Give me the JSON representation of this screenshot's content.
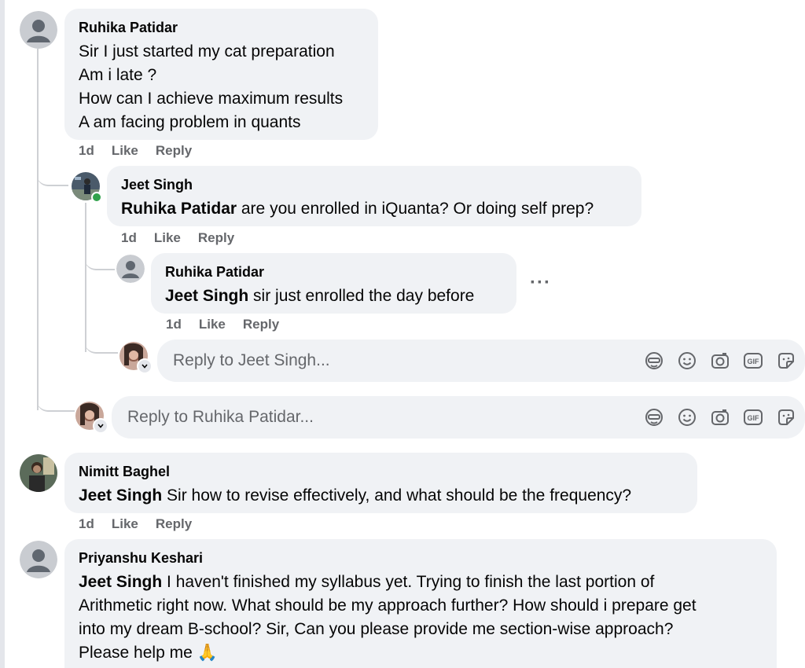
{
  "comments": {
    "c1": {
      "author": "Ruhika Patidar",
      "lines": [
        "Sir I just started my cat preparation",
        "Am i late ?",
        "How can I achieve maximum results",
        "A am facing problem in quants"
      ],
      "time": "1d",
      "like": "Like",
      "reply": "Reply"
    },
    "c2": {
      "author": "Jeet Singh",
      "mention": "Ruhika Patidar",
      "text": " are you enrolled in iQuanta? Or doing self prep?",
      "time": "1d",
      "like": "Like",
      "reply": "Reply"
    },
    "c3": {
      "author": "Ruhika Patidar",
      "mention": "Jeet Singh",
      "text": " sir just enrolled the day before",
      "time": "1d",
      "like": "Like",
      "reply": "Reply",
      "more": "···"
    },
    "c4": {
      "author": "Nimitt Baghel",
      "mention": "Jeet Singh",
      "text": " Sir how to revise effectively, and what should be the frequency?",
      "time": "1d",
      "like": "Like",
      "reply": "Reply"
    },
    "c5": {
      "author": "Priyanshu Keshari",
      "mention": "Jeet Singh",
      "line1": " I haven't finished my syllabus yet. Trying to finish the last portion of",
      "line2": "Arithmetic right now. What should be my approach further? How should i prepare get",
      "line3": "into my dream B-school? Sir, Can you please provide me section-wise approach?",
      "line4": "Please help me 🙏"
    }
  },
  "reply_boxes": {
    "jeet": {
      "placeholder": "Reply to Jeet Singh..."
    },
    "ruhika": {
      "placeholder": "Reply to Ruhika Patidar..."
    }
  },
  "icons": [
    "avatar-sticker-icon",
    "emoji-icon",
    "camera-icon",
    "gif-icon",
    "sticker-icon"
  ],
  "gif_label": "GIF",
  "colors": {
    "bubble": "#f0f2f5",
    "meta": "#65676b",
    "online": "#31a24c",
    "thread": "#ced0d4"
  }
}
